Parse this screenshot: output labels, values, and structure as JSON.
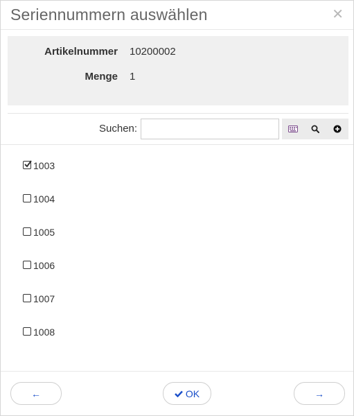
{
  "dialog": {
    "title": "Seriennummern auswählen",
    "close_icon": "close-icon"
  },
  "info": {
    "article_label": "Artikelnummer",
    "article_value": "10200002",
    "quantity_label": "Menge",
    "quantity_value": "1"
  },
  "search": {
    "label": "Suchen:",
    "value": "",
    "placeholder": "",
    "keyboard_icon": "keyboard-icon",
    "search_icon": "search-icon",
    "add_icon": "plus-circle-icon"
  },
  "serials": [
    {
      "number": "1003",
      "checked": true
    },
    {
      "number": "1004",
      "checked": false
    },
    {
      "number": "1005",
      "checked": false
    },
    {
      "number": "1006",
      "checked": false
    },
    {
      "number": "1007",
      "checked": false
    },
    {
      "number": "1008",
      "checked": false
    }
  ],
  "footer": {
    "prev_label": "←",
    "ok_label": "OK",
    "next_label": "→",
    "ok_icon": "check-icon"
  },
  "colors": {
    "accent": "#1a4fc9",
    "info_background": "#f0f0f0",
    "toolbar_button": "#ebebeb"
  }
}
